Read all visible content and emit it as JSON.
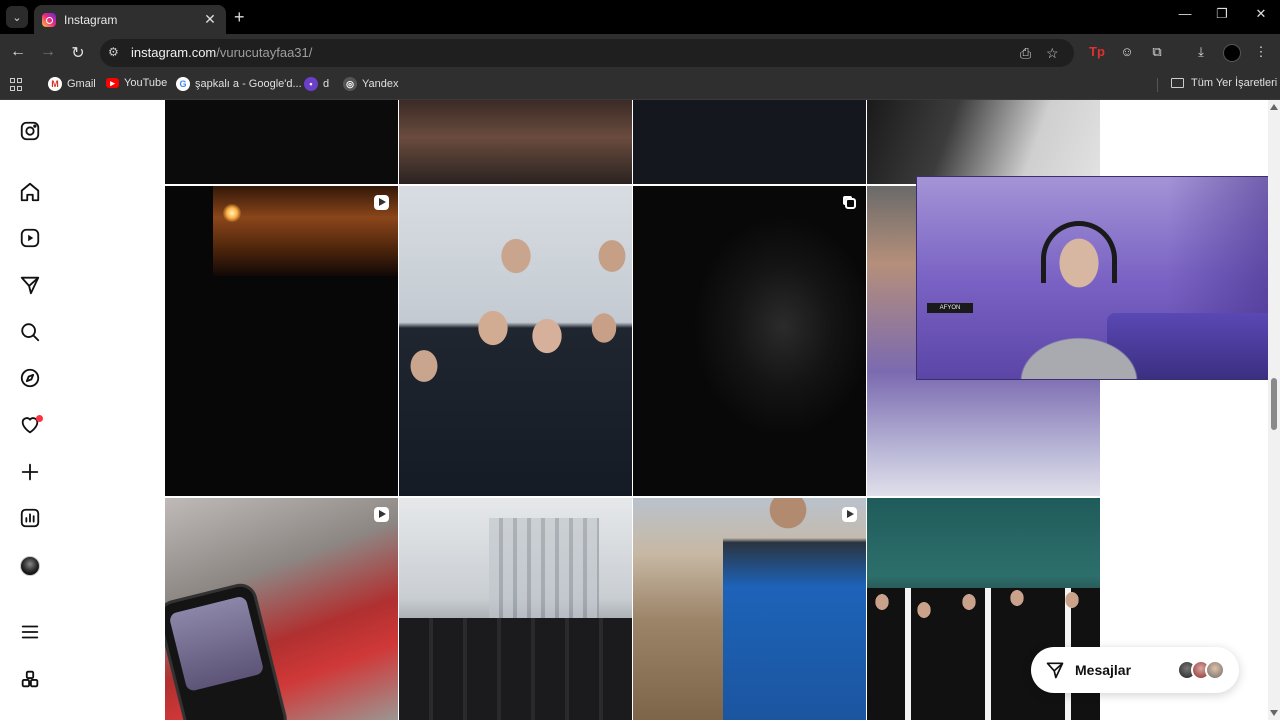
{
  "browser": {
    "tab_title": "Instagram",
    "url_host": "instagram.com",
    "url_path": "/vurucutayfaa31/",
    "bookmarks": [
      {
        "label": "Gmail",
        "icon": "gmail-icon"
      },
      {
        "label": "YouTube",
        "icon": "youtube-icon"
      },
      {
        "label": "şapkalı a - Google'd...",
        "icon": "google-icon"
      },
      {
        "label": "d",
        "icon": "bookmark-icon"
      },
      {
        "label": "Yandex",
        "icon": "globe-icon"
      }
    ],
    "all_bookmarks_label": "Tüm Yer İşaretleri"
  },
  "sidebar": {
    "items": [
      {
        "name": "instagram-logo-icon"
      },
      {
        "name": "home-icon"
      },
      {
        "name": "reels-icon"
      },
      {
        "name": "messages-icon"
      },
      {
        "name": "search-icon"
      },
      {
        "name": "explore-icon"
      },
      {
        "name": "notifications-icon",
        "has_dot": true
      },
      {
        "name": "create-icon"
      },
      {
        "name": "dashboard-icon"
      },
      {
        "name": "profile-avatar"
      },
      {
        "name": "more-menu-icon"
      },
      {
        "name": "also-from-meta-icon"
      }
    ]
  },
  "webcam": {
    "sign_text": "AFYON"
  },
  "messages_pill": {
    "label": "Mesajlar"
  },
  "colors": {
    "notification_dot": "#ff3040",
    "browser_chrome": "#2f2f2f"
  }
}
